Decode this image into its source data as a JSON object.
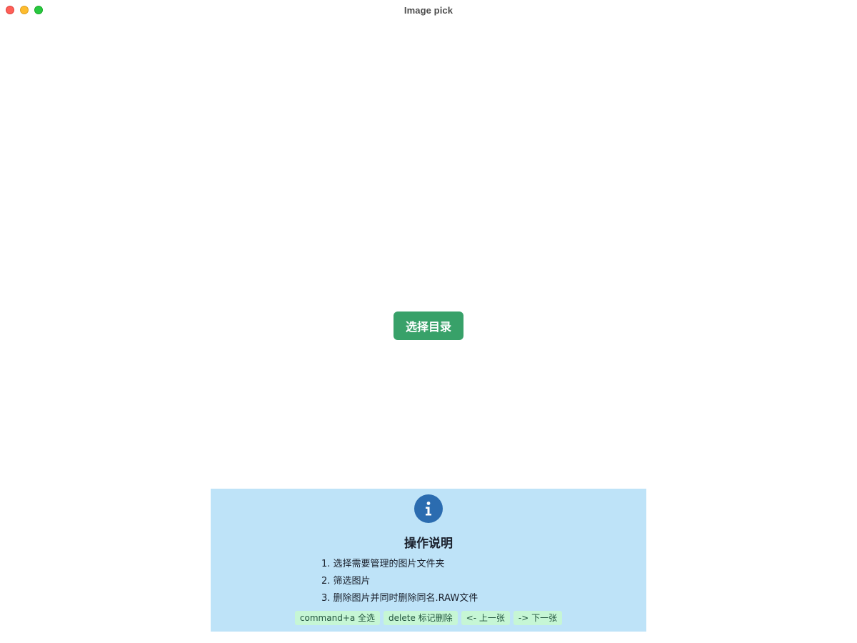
{
  "window": {
    "title": "Image pick"
  },
  "main": {
    "choose_button_label": "选择目录"
  },
  "info": {
    "icon": "info-icon",
    "title": "操作说明",
    "steps": [
      "1. 选择需要管理的图片文件夹",
      "2. 筛选图片",
      "3. 删除图片并同时删除同名.RAW文件"
    ],
    "shortcuts": [
      "command+a 全选",
      "delete 标记删除",
      "<- 上一张",
      "-> 下一张"
    ]
  },
  "colors": {
    "button": "#38a169",
    "info_background": "#bee3f8",
    "info_icon": "#2b6cb0",
    "shortcut_badge": "#c6f6d5"
  }
}
